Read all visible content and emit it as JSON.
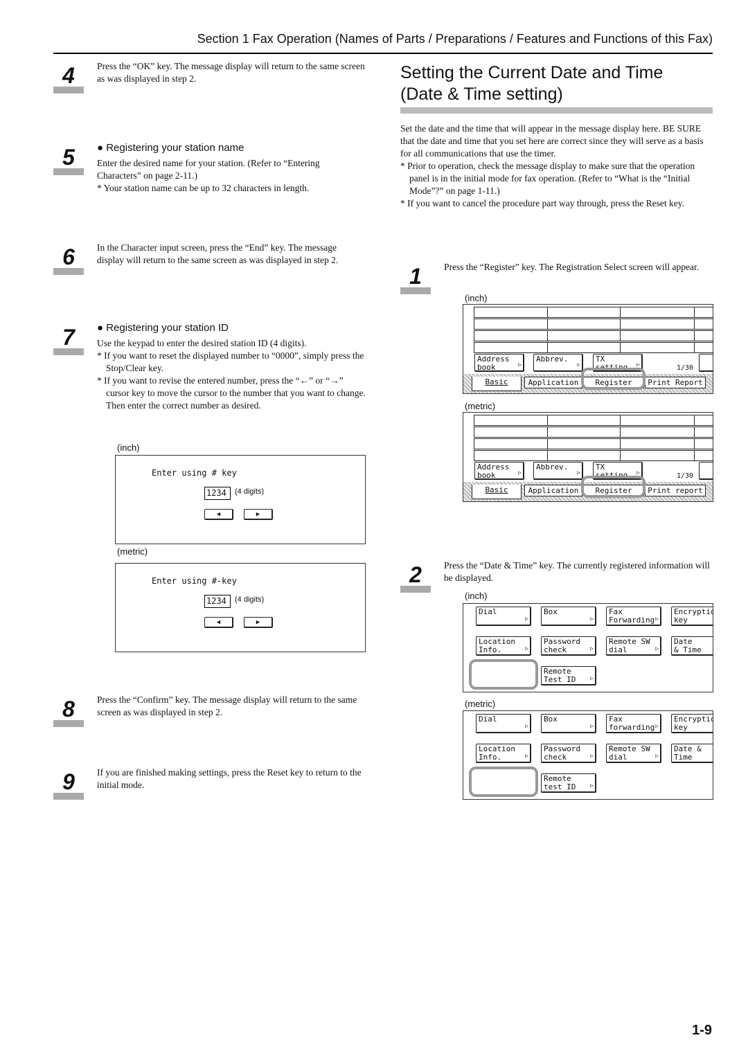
{
  "header": "Section 1  Fax Operation (Names of Parts / Preparations / Features and Functions of this Fax)",
  "title_lines": [
    "Setting the Current Date and Time",
    "(Date & Time setting)"
  ],
  "intro": {
    "para": "Set the date and the time that will appear in the message display here. BE SURE that the date and time that you set here are correct since they will serve as a basis for all communications that use the timer.",
    "notes": [
      "* Prior to operation, check the message display to make sure that the operation panel is in the initial mode for fax operation. (Refer to “What is the “Initial Mode”?” on page 1-11.)",
      "* If you want to cancel the procedure part way through, press the Reset key."
    ]
  },
  "left_steps": [
    {
      "num": "4",
      "lines": [
        "Press the “OK” key. The message display will return to the same screen as was displayed in step 2."
      ]
    },
    {
      "num": "5",
      "sub": "● Registering your station name",
      "lines": [
        "Enter the desired name for your station. (Refer to “Entering Characters” on page 2-11.)"
      ],
      "notes": [
        "* Your station name can be up to 32 characters in length."
      ]
    },
    {
      "num": "6",
      "lines": [
        "In the Character input screen, press the “End” key. The message display will return to the same screen as was displayed in step 2."
      ]
    },
    {
      "num": "7",
      "sub": "● Registering your station ID",
      "lines": [
        "Use the keypad to enter the desired station ID (4 digits)."
      ],
      "notes": [
        "* If you want to reset the displayed number to “0000”, simply press the Stop/Clear key.",
        "* If you want to revise the entered number, press the “←” or “→” cursor key to move the cursor to the number that you want to change. Then enter the correct number as desired."
      ]
    },
    {
      "num": "8",
      "lines": [
        "Press the “Confirm” key. The message display will return to the same screen as was displayed in step 2."
      ]
    },
    {
      "num": "9",
      "lines": [
        "If you are finished making settings, press the Reset key to return to the initial mode."
      ]
    }
  ],
  "right_steps": [
    {
      "num": "1",
      "lines": [
        "Press the “Register” key. The Registration Select screen will appear."
      ]
    },
    {
      "num": "2",
      "lines": [
        "Press the “Date & Time” key. The currently registered information will be displayed."
      ]
    }
  ],
  "captions": {
    "inch": "(inch)",
    "metric": "(metric)"
  },
  "id_screens": [
    {
      "prompt": "Enter using # key",
      "value": "1234",
      "hint": "(4 digits)",
      "left": "◀",
      "right": "▶"
    },
    {
      "prompt": "Enter using #-key",
      "value": "1234",
      "hint": "(4 digits)",
      "left": "◀",
      "right": "▶"
    }
  ],
  "register_screens": [
    {
      "buttons": [
        "Address\nbook",
        "Abbrev.",
        "TX\nsetting"
      ],
      "page": "1/30",
      "tabs": [
        "Basic",
        "Application",
        "Register",
        "Print Report"
      ]
    },
    {
      "buttons": [
        "Address\nbook",
        "Abbrev.",
        "TX\nsetting"
      ],
      "page": "1/30",
      "tabs": [
        "Basic",
        "Application",
        "Register",
        "Print report"
      ]
    }
  ],
  "datetime_screens": [
    {
      "buttons": [
        "Dial",
        "Box",
        "Fax\nForwarding",
        "Encryption\nkey",
        "Location\nInfo.",
        "Password\ncheck",
        "Remote SW\ndial",
        "Date\n& Time",
        "",
        "Remote\nTest ID"
      ]
    },
    {
      "buttons": [
        "Dial",
        "Box",
        "Fax\nforwarding",
        "Encryption\nkey",
        "Location\nInfo.",
        "Password\ncheck",
        "Remote SW\ndial",
        "Date &\nTime",
        "",
        "Remote\ntest ID"
      ]
    }
  ],
  "page_number": "1-9",
  "colors": {
    "highlight": "#999999",
    "step_bar": "#aaaaaa"
  }
}
